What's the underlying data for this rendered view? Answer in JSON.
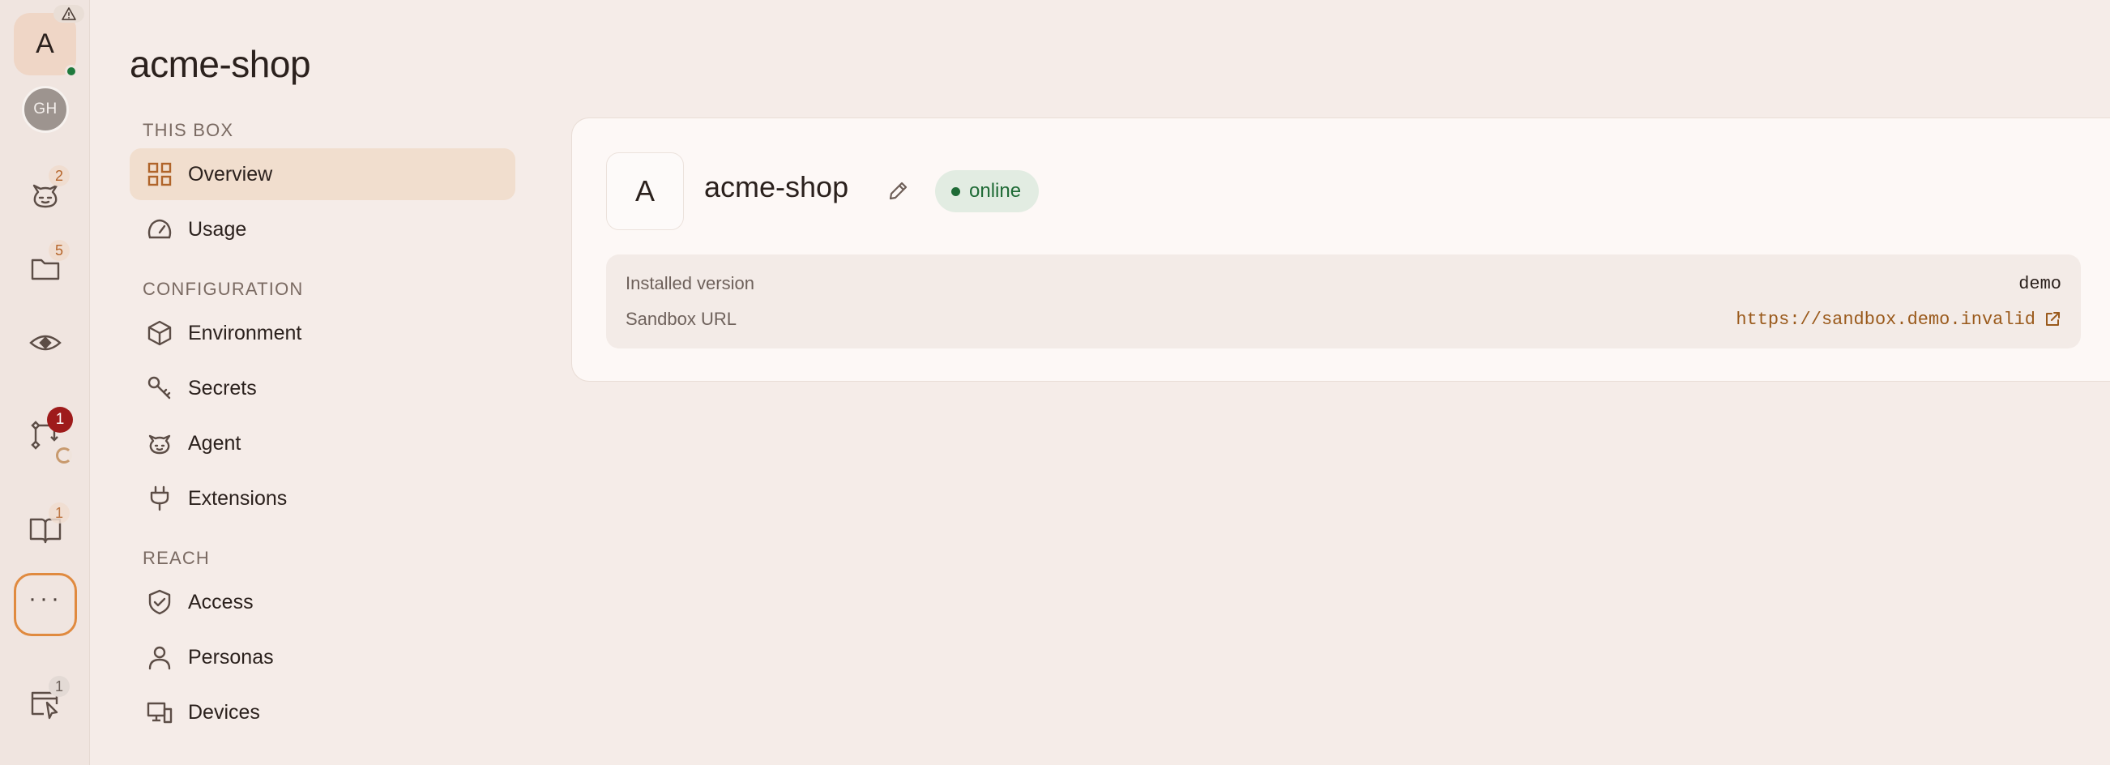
{
  "rail": {
    "workspace_initial": "A",
    "user_initials": "GH",
    "badges": {
      "agent_count": "2",
      "files_count": "5",
      "changes_count": "1",
      "docs_count": "1",
      "sessions_count": "1"
    },
    "more_label": "···"
  },
  "page": {
    "title": "acme-shop"
  },
  "nav": {
    "sections": [
      {
        "label": "THIS BOX",
        "items": [
          "Overview",
          "Usage"
        ]
      },
      {
        "label": "CONFIGURATION",
        "items": [
          "Environment",
          "Secrets",
          "Agent",
          "Extensions"
        ]
      },
      {
        "label": "REACH",
        "items": [
          "Access",
          "Personas",
          "Devices"
        ]
      }
    ],
    "active": "Overview"
  },
  "card": {
    "avatar_initial": "A",
    "name": "acme-shop",
    "status": "online",
    "details": [
      {
        "key": "Installed version",
        "value": "demo"
      },
      {
        "key": "Sandbox URL",
        "value": "https://sandbox.demo.invalid"
      }
    ]
  },
  "colors": {
    "accent": "#b0642a",
    "online": "#1f6b36",
    "alert": "#9e1b1b",
    "focus_ring": "#e08a3f"
  }
}
